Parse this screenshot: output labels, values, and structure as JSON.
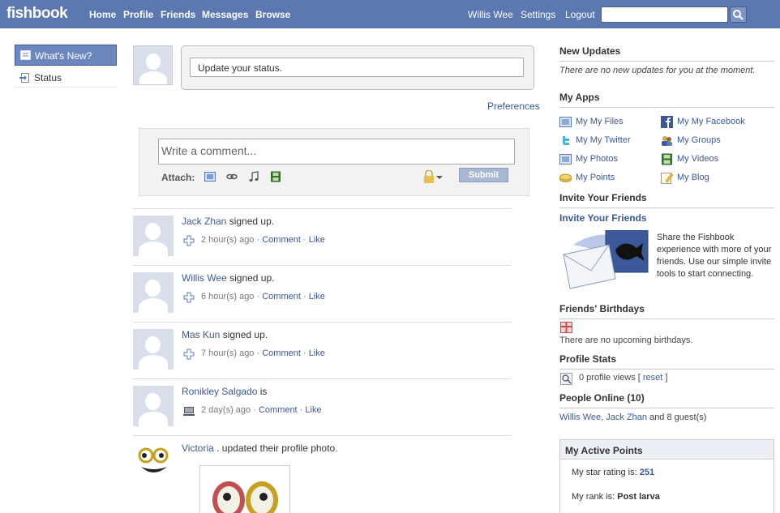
{
  "brand": {
    "logo": "fishbook"
  },
  "nav": {
    "home": "Home",
    "profile": "Profile",
    "friends": "Friends",
    "messages": "Messages",
    "browse": "Browse"
  },
  "user_nav": {
    "name": "Willis Wee",
    "settings": "Settings",
    "logout": "Logout"
  },
  "search": {
    "placeholder": ""
  },
  "sidebar": {
    "whats_new": "What's New?",
    "status": "Status"
  },
  "status_box": {
    "placeholder": "Update your status."
  },
  "preferences": "Preferences",
  "comment": {
    "placeholder": "Write a comment...",
    "attach_label": "Attach:",
    "submit": "Submit"
  },
  "feed": [
    {
      "name": "Jack Zhan",
      "action": " signed up.",
      "time": "2 hour(s) ago",
      "comment": "Comment",
      "like": "Like"
    },
    {
      "name": "Willis Wee",
      "action": " signed up.",
      "time": "6 hour(s) ago",
      "comment": "Comment",
      "like": "Like"
    },
    {
      "name": "Mas Kun",
      "action": " signed up.",
      "time": "7 hour(s) ago",
      "comment": "Comment",
      "like": "Like"
    },
    {
      "name": "Ronikley Salgado",
      "action": " is",
      "time": "2 day(s) ago",
      "comment": "Comment",
      "like": "Like"
    },
    {
      "name": "Victoria",
      "action": " . updated their profile photo."
    }
  ],
  "right": {
    "new_updates": {
      "title": "New Updates",
      "text": "There are no new updates for you at the moment."
    },
    "my_apps": {
      "title": "My Apps",
      "items": [
        "My My Files",
        "My My Facebook",
        "My My Twitter",
        "My Groups",
        "My Photos",
        "My Videos",
        "My Points",
        "My Blog"
      ]
    },
    "invite": {
      "title": "Invite Your Friends",
      "link": "Invite Your Friends",
      "text": "Share the Fishbook experience with more of your friends. Use our simple invite tools to start connecting."
    },
    "birthdays": {
      "title": "Friends' Birthdays",
      "text": "There are no upcoming birthdays."
    },
    "profile_stats": {
      "title": "Profile Stats",
      "views": "0 profile views [",
      "reset": "reset",
      "close": " ]"
    },
    "people_online": {
      "title": "People Online (10)",
      "user1": "Willis Wee",
      "sep": ", ",
      "user2": "Jack Zhan",
      "rest": " and 8 guest(s)"
    },
    "points": {
      "title": "My Active Points",
      "star_label": "My star rating is: ",
      "star_value": "251",
      "rank_label": "My rank is: ",
      "rank_value": "Post larva"
    }
  },
  "colors": {
    "topbar": "#5b78b0",
    "link": "#3b5998",
    "avatar_bg": "#d8dfea"
  }
}
